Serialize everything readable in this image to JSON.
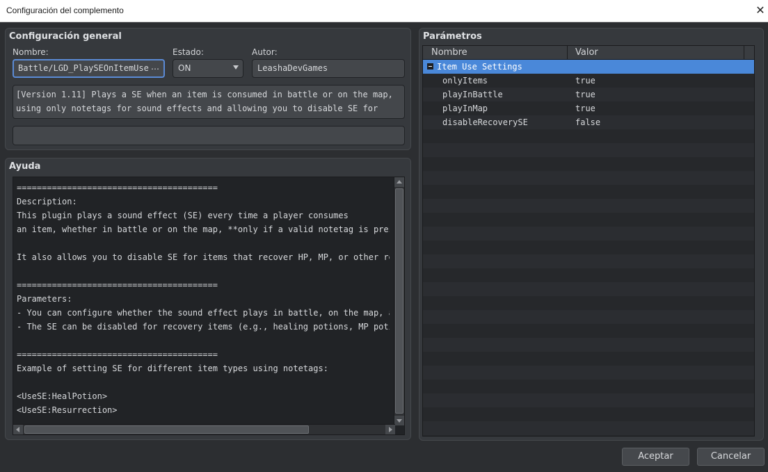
{
  "window": {
    "title": "Configuración del complemento",
    "close_glyph": "✕"
  },
  "general": {
    "title": "Configuración general",
    "name_label": "Nombre:",
    "name_value": "Battle/LGD_PlaySEOnItemUse",
    "name_button": "…",
    "status_label": "Estado:",
    "status_value": "ON",
    "author_label": "Autor:",
    "author_value": "LeashaDevGames",
    "description": "[Version 1.11] Plays a SE when an item is consumed in battle or on the map,\nusing only notetags for sound effects and allowing you to disable SE for",
    "extra_value": ""
  },
  "help": {
    "title": "Ayuda",
    "text": "========================================\nDescription:\nThis plugin plays a sound effect (SE) every time a player consumes\nan item, whether in battle or on the map, **only if a valid notetag is present**\n\nIt also allows you to disable SE for items that recover HP, MP, or other resources.\n\n========================================\nParameters:\n- You can configure whether the sound effect plays in battle, on the map, and\n- The SE can be disabled for recovery items (e.g., healing potions, MP potions).\n\n========================================\nExample of setting SE for different item types using notetags:\n\n<UseSE:HealPotion>\n<UseSE:Resurrection>\n<NoSE>"
  },
  "params": {
    "title": "Parámetros",
    "columns": {
      "name": "Nombre",
      "value": "Valor"
    },
    "group": "Item Use Settings",
    "rows": [
      {
        "name": "onlyItems",
        "value": "true"
      },
      {
        "name": "playInBattle",
        "value": "true"
      },
      {
        "name": "playInMap",
        "value": "true"
      },
      {
        "name": "disableRecoverySE",
        "value": "false"
      }
    ]
  },
  "buttons": {
    "ok": "Aceptar",
    "cancel": "Cancelar"
  },
  "colors": {
    "accent": "#4a88d9",
    "background": "#2c2e31"
  }
}
